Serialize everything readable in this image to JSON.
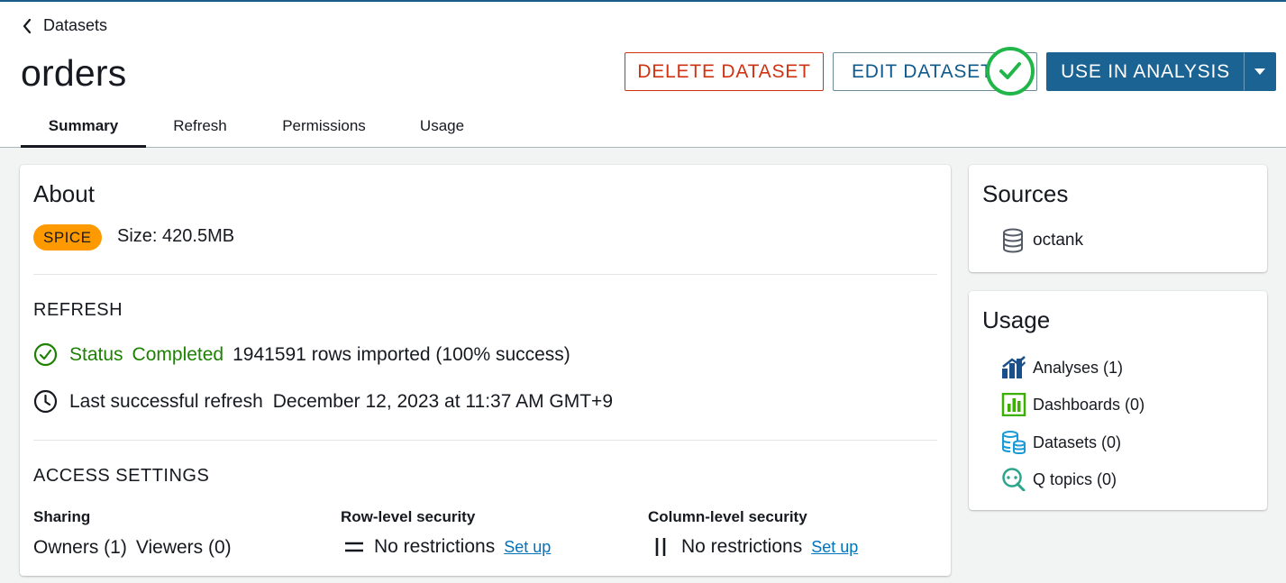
{
  "breadcrumb": {
    "label": "Datasets"
  },
  "page": {
    "title": "orders"
  },
  "actions": {
    "delete_label": "DELETE DATASET",
    "edit_label": "EDIT DATASET",
    "use_label": "USE IN ANALYSIS"
  },
  "tabs": [
    {
      "label": "Summary",
      "active": true
    },
    {
      "label": "Refresh",
      "active": false
    },
    {
      "label": "Permissions",
      "active": false
    },
    {
      "label": "Usage",
      "active": false
    }
  ],
  "about": {
    "title": "About",
    "storage_badge": "SPICE",
    "size": "Size: 420.5MB",
    "refresh": {
      "heading": "REFRESH",
      "status_label": "Status",
      "status_value": "Completed",
      "rows_text": "1941591 rows imported (100% success)",
      "last_refresh_label": "Last successful refresh",
      "last_refresh_value": "December 12, 2023 at 11:37 AM GMT+9"
    },
    "access": {
      "heading": "ACCESS SETTINGS",
      "sharing_label": "Sharing",
      "owners": "Owners (1)",
      "viewers": "Viewers (0)",
      "rls_label": "Row-level security",
      "rls_value": "No restrictions",
      "cls_label": "Column-level security",
      "cls_value": "No restrictions",
      "setup_link": "Set up"
    }
  },
  "sources": {
    "title": "Sources",
    "items": [
      {
        "label": "octank",
        "icon": "database-icon"
      }
    ]
  },
  "usage": {
    "title": "Usage",
    "items": [
      {
        "label": "Analyses (1)",
        "icon": "analyses-icon"
      },
      {
        "label": "Dashboards (0)",
        "icon": "dashboards-icon"
      },
      {
        "label": "Datasets (0)",
        "icon": "datasets-icon"
      },
      {
        "label": "Q topics (0)",
        "icon": "q-topics-icon"
      }
    ]
  },
  "colors": {
    "primary": "#1b6392",
    "danger": "#d13212",
    "success": "#1d8102",
    "spice": "#ff9900",
    "check_badge": "#21b64a"
  }
}
